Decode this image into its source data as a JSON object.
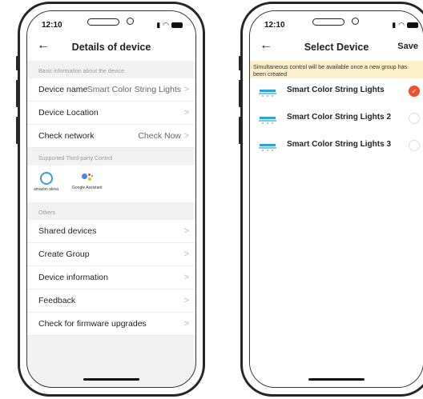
{
  "left": {
    "status_time": "12:10",
    "title": "Details of device",
    "section_basic": "Basic information about the device",
    "device_name_label": "Device name",
    "device_name_value": "Smart Color String Lights",
    "device_location_label": "Device Location",
    "check_network_label": "Check network",
    "check_network_value": "Check Now",
    "section_third_party": "Supported Third-party Control",
    "alexa_label": "amazon alexa",
    "google_label": "Google Assistant",
    "section_others": "Others",
    "items": [
      "Shared devices",
      "Create Group",
      "Device information",
      "Feedback",
      "Check for firmware upgrades"
    ]
  },
  "right": {
    "status_time": "12:10",
    "title": "Select Device",
    "save_label": "Save",
    "banner": "Simultaneous control will be available once a new group has been created",
    "devices": [
      "Smart Color String Lights",
      "Smart Color String Lights 2",
      "Smart Color String Lights 3"
    ],
    "check_mark": "✓"
  },
  "colors": {
    "accent": "#f0502e",
    "banner_bg": "#fcefc9",
    "alexa": "#2fa3d9"
  }
}
